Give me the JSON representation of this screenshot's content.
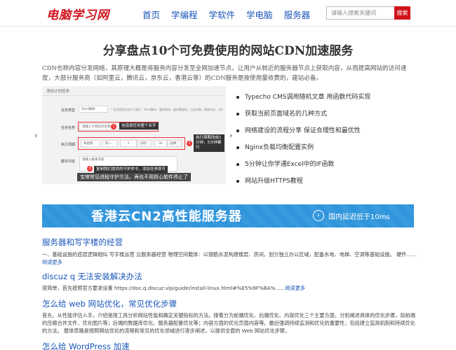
{
  "header": {
    "logo": "电脑学习网",
    "nav": [
      "首页",
      "学编程",
      "学软件",
      "学电脑",
      "服务器"
    ],
    "search_placeholder": "请输入搜索关键词",
    "search_button": "搜索"
  },
  "page": {
    "title": "分享盘点10个可免费使用的网站CDN加速服务",
    "intro": "CDN也称内容分发网络，其原理大概是将服务内容分发至全网加速节点，让用户从就近的服务器节点上获取内容，从而提高网站的访问速度，大部分服务商（如阿里云，腾讯云，京东云，香港云等）的CDN服务是按使用量收费的，建站必备。"
  },
  "slider": {
    "form_title": "添加计划任务",
    "rows": [
      "任务类型",
      "任务名称",
      "执行周期",
      "脚本内容"
    ],
    "task_type_value": "Shell脚本",
    "task_type_hint": "* 任务类型包含以下部分：Shell脚本，备份网站，备份数据库，日志切割，释放内存，访问URL",
    "task_name_placeholder": "请输入计划任务名称",
    "period_value": "每星期",
    "period_day": "周一",
    "period_num": "1",
    "period_hour_label": "小时",
    "period_min": "30",
    "period_min_label": "分钟",
    "script_placeholder": "请输入脚本内容",
    "tip1": "信道按任务整个名字",
    "tip2": "执行周期改成1分钟，5分钟都行",
    "tip3": "复制我们提供的守护命令，添加任务即可",
    "caption": "宝塔常见进程守护方法，再也不用担心软件停止了",
    "prev_arrow": "‹",
    "next_arrow": "›"
  },
  "related": [
    "Typecho CMS调用随机文章 用函数代码实现",
    "获取当前页面域名的几种方式",
    "网络建设的流程分享 保证合理性和最优性",
    "Nginx负载均衡配置实例",
    "5分钟让你学通Excel中的IF函数",
    "网站升级HTTPS教程"
  ],
  "banner": {
    "title": "香港云CN2高性能服务器",
    "subtitle": "国内延迟低于10ms",
    "arrow": "›"
  },
  "articles": [
    {
      "title": "服务器和写字楼的经营",
      "excerpt": "一、基础设施的底层逻辑相似 写字楼运营 云服务器经营 物理空间载体：以钢筋水泥构建楼层、房间，划分独立办公区域，配备水电、电梯、空调等基础设施。 硬件......",
      "more": "阅读更多"
    },
    {
      "title": "discuz q 无法安装解决办法",
      "excerpt": "很简单，首先按照官方要求设置 https://doc.q.discuz.vip/guide/install-linux.html#%E5%9F%BA%......",
      "more": "阅读更多"
    },
    {
      "title": "怎么给 web 网站优化，常见优化步骤",
      "excerpt": "首先，从性能评估入手，介绍使用工具分析网站性能和确定关键指标的方法。接着分为前端优化、后端优化、内容优化三个主要方面，分别阐述具体的优化步骤，如前端的压缩合并文件、优化图片等；后端的数据库优化、服务器配置优化等；内容方面的优化页面内容等。最后强调持续监测和优化的重要性，包括建立监测机制和持续优化的方法。 整体思路是按照网站优化的流程和常见的优化领域进行逐步阐述，以提供全面的 Web 网站优化步骤。",
      "more": ""
    },
    {
      "title": "怎么给 WordPress 加速",
      "excerpt": "",
      "more": ""
    }
  ]
}
